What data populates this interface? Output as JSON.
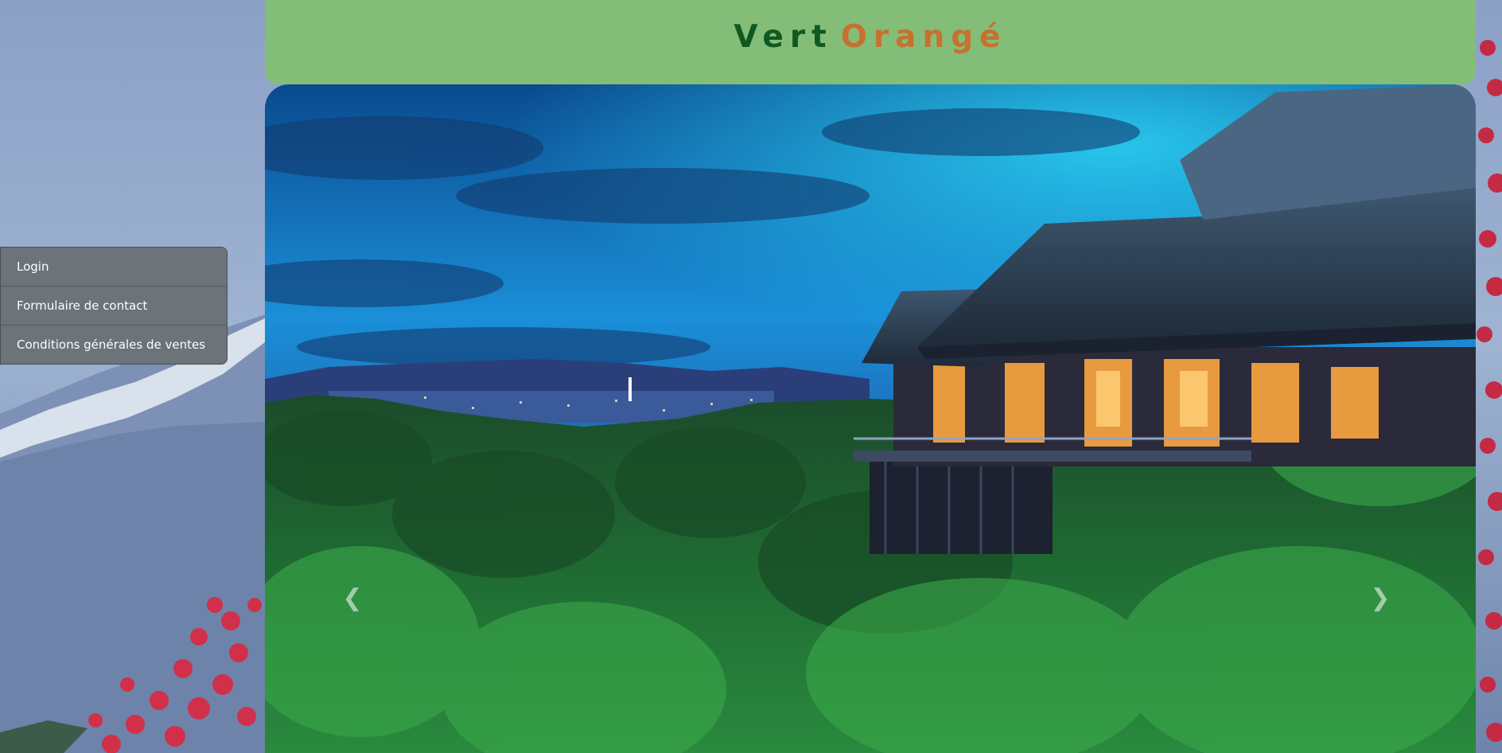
{
  "header": {
    "brand_part1": "Vert",
    "brand_part2": "Orangé"
  },
  "menu": {
    "items": [
      {
        "label": "Login"
      },
      {
        "label": "Formulaire de contact"
      },
      {
        "label": "Conditions générales de ventes"
      }
    ]
  },
  "carousel": {
    "prev_icon": "chevron-left-icon",
    "next_icon": "chevron-right-icon",
    "prev_glyph": "❮",
    "next_glyph": "❯"
  },
  "colors": {
    "header_bg": "#84bd78",
    "brand_green": "#0f5a22",
    "brand_orange": "#c8712f",
    "menu_bg": "#6c7379"
  }
}
